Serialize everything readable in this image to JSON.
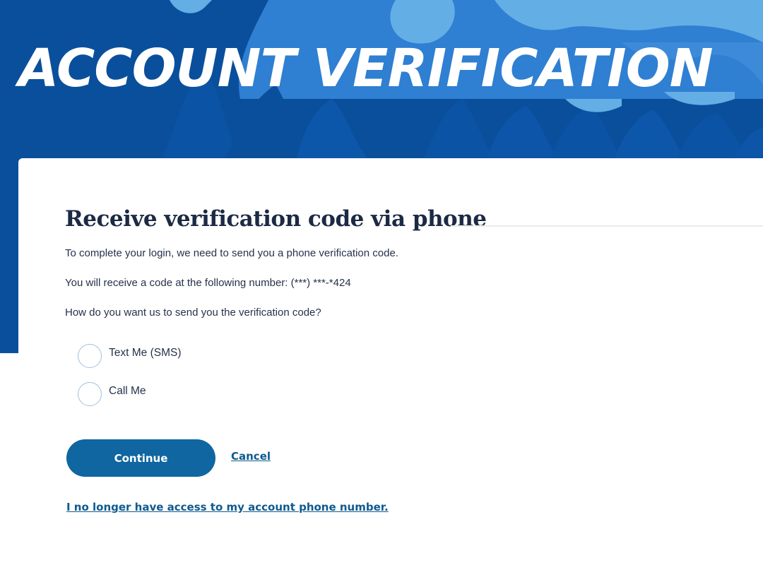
{
  "hero": {
    "title": "ACCOUNT VERIFICATION",
    "colors": {
      "dark_blue": "#0a4f9c",
      "mid_blue": "#2f7fd2",
      "light_blue": "#64aee6"
    }
  },
  "card": {
    "heading": "Receive verification code via phone",
    "intro": "To complete your login, we need to send you a phone verification code.",
    "number_text": "You will receive a code at the following number: (***) ***-*424",
    "question": "How do you want us to send you the verification code?",
    "options": [
      {
        "label": "Text Me (SMS)",
        "selected": false
      },
      {
        "label": "Call Me",
        "selected": false
      }
    ],
    "continue_label": "Continue",
    "cancel_label": "Cancel",
    "no_access_label": "I no longer have access to my account phone number."
  },
  "colors": {
    "primary_button": "#0f66a1",
    "link": "#0f5a8e",
    "heading_text": "#1c2a44"
  }
}
